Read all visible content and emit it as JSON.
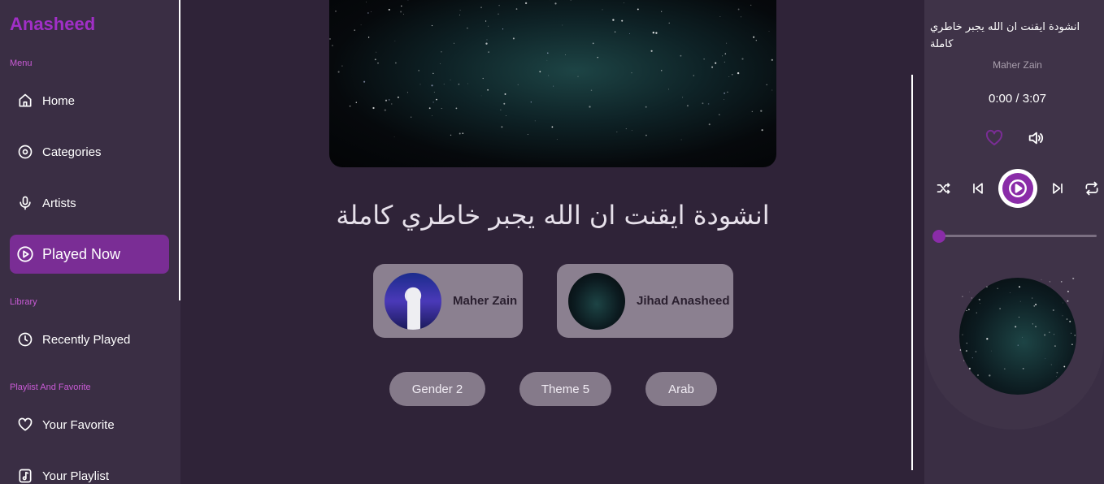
{
  "app": {
    "logo": "Anasheed",
    "accent": "#a12fc7",
    "active_bg": "#7a2d95"
  },
  "sidebar": {
    "sections": [
      {
        "label": "Menu"
      },
      {
        "label": "Library"
      },
      {
        "label": "Playlist And Favorite"
      }
    ],
    "items": [
      {
        "label": "Home",
        "icon": "home-icon"
      },
      {
        "label": "Categories",
        "icon": "disc-icon"
      },
      {
        "label": "Artists",
        "icon": "microphone-icon"
      },
      {
        "label": "Played Now",
        "icon": "play-circle-icon",
        "active": true
      },
      {
        "label": "Recently Played",
        "icon": "clock-icon"
      },
      {
        "label": "Your Favorite",
        "icon": "heart-icon"
      },
      {
        "label": "Your Playlist",
        "icon": "playlist-icon"
      }
    ]
  },
  "main": {
    "song_title": "انشودة ايقنت ان الله يجبر خاطري كاملة",
    "artists": [
      {
        "name": "Maher Zain"
      },
      {
        "name": "Jihad Anasheed"
      }
    ],
    "tags": [
      "Gender 2",
      "Theme 5",
      "Arab"
    ]
  },
  "player": {
    "title": "انشودة ايقنت ان الله يجبر خاطري كاملة",
    "artist": "Maher Zain",
    "time": "0:00 / 3:07",
    "progress": 0.0
  }
}
